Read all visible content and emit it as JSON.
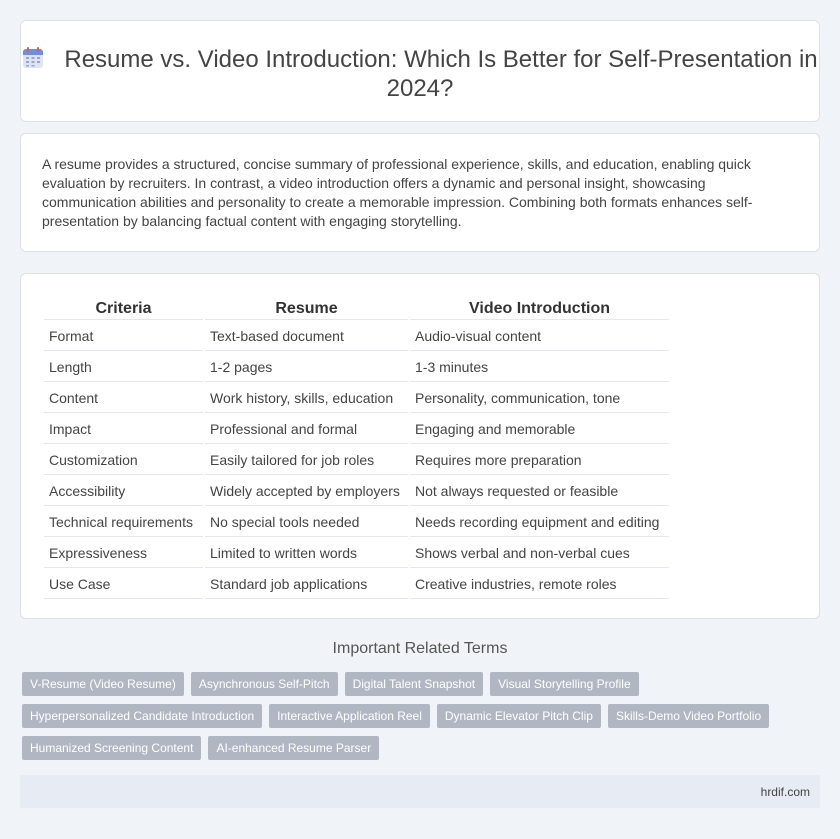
{
  "header": {
    "title": "Resume vs. Video Introduction: Which Is Better for Self-Presentation in 2024?",
    "icon": "calendar-icon"
  },
  "summary": {
    "text": "A resume provides a structured, concise summary of professional experience, skills, and education, enabling quick evaluation by recruiters. In contrast, a video introduction offers a dynamic and personal insight, showcasing communication abilities and personality to create a memorable impression. Combining both formats enhances self-presentation by balancing factual content with engaging storytelling."
  },
  "comparison": {
    "headers": [
      "Criteria",
      "Resume",
      "Video Introduction"
    ],
    "rows": [
      [
        "Format",
        "Text-based document",
        "Audio-visual content"
      ],
      [
        "Length",
        "1-2 pages",
        "1-3 minutes"
      ],
      [
        "Content",
        "Work history, skills, education",
        "Personality, communication, tone"
      ],
      [
        "Impact",
        "Professional and formal",
        "Engaging and memorable"
      ],
      [
        "Customization",
        "Easily tailored for job roles",
        "Requires more preparation"
      ],
      [
        "Accessibility",
        "Widely accepted by employers",
        "Not always requested or feasible"
      ],
      [
        "Technical requirements",
        "No special tools needed",
        "Needs recording equipment and editing"
      ],
      [
        "Expressiveness",
        "Limited to written words",
        "Shows verbal and non-verbal cues"
      ],
      [
        "Use Case",
        "Standard job applications",
        "Creative industries, remote roles"
      ]
    ]
  },
  "related": {
    "title": "Important Related Terms",
    "tags": [
      "V-Resume (Video Resume)",
      "Asynchronous Self-Pitch",
      "Digital Talent Snapshot",
      "Visual Storytelling Profile",
      "Hyperpersonalized Candidate Introduction",
      "Interactive Application Reel",
      "Dynamic Elevator Pitch Clip",
      "Skills-Demo Video Portfolio",
      "Humanized Screening Content",
      "AI-enhanced Resume Parser"
    ]
  },
  "footer": {
    "site": "hrdif.com"
  }
}
